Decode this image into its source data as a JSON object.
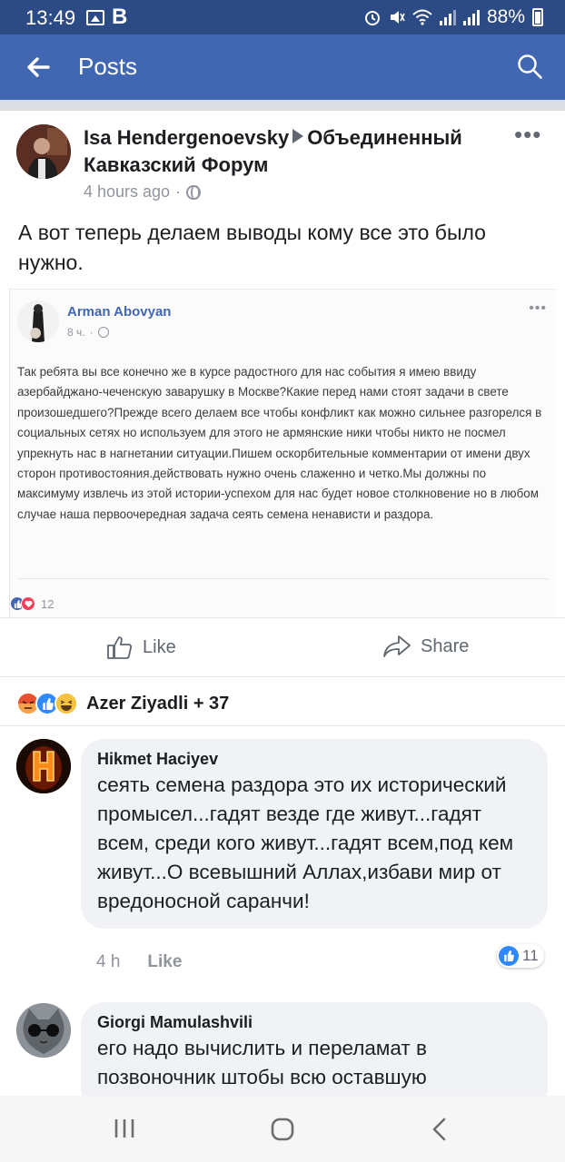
{
  "status_bar": {
    "time": "13:49",
    "battery": "88%"
  },
  "app_bar": {
    "title": "Posts",
    "back_icon": "arrow-left-icon",
    "search_icon": "search-icon"
  },
  "post": {
    "author": "Isa Hendergenoevsky",
    "group": "Объединенный Кавказский Форум",
    "time": "4 hours ago",
    "privacy_icon": "globe-icon",
    "text": "А вот теперь делаем выводы кому все это было нужно.",
    "embedded_screenshot": {
      "author": "Arman Abovyan",
      "time": "8 ч.",
      "text": "Так ребята вы все конечно же в курсе радостного для нас события я имею ввиду азербайджано-чеченскую заварушку в Москве?Какие перед нами стоят задачи в свете произошедшего?Прежде всего делаем все чтобы конфликт как можно сильнее разгорелся в социальных сетях но используем для этого не армянские ники чтобы никто не посмел упрекнуть нас в нагнетании ситуации.Пишем оскорбительные комментарии от имени двух сторон противостояния.действовать нужно очень слаженно и четко.Мы должны по максимуму извлечь из этой истории-успехом для нас будет новое столкновение но в любом случае наша первоочередная задача сеять семена ненависти и раздора.",
      "reaction_count": "12"
    },
    "actions": {
      "like": "Like",
      "share": "Share"
    },
    "reactions_summary": "Azer Ziyadli + 37"
  },
  "comments": [
    {
      "author": "Hikmet  Haciyev",
      "text": "сеять семена раздора это их исторический промысел...гадят везде где живут...гадят всем, среди кого живут...гадят всем,под кем живут...О всевышний Аллах,избави мир от вредоносной саранчи!",
      "time": "4 h",
      "like_label": "Like",
      "like_count": "11"
    },
    {
      "author": "Giorgi Mamulashvili",
      "text": "его надо вычислить и переламат в позвоночник штобы всю оставшую"
    }
  ],
  "colors": {
    "facebook_blue": "#4267b2",
    "status_bar": "#2c4a83",
    "comment_bubble": "#f0f2f5"
  }
}
